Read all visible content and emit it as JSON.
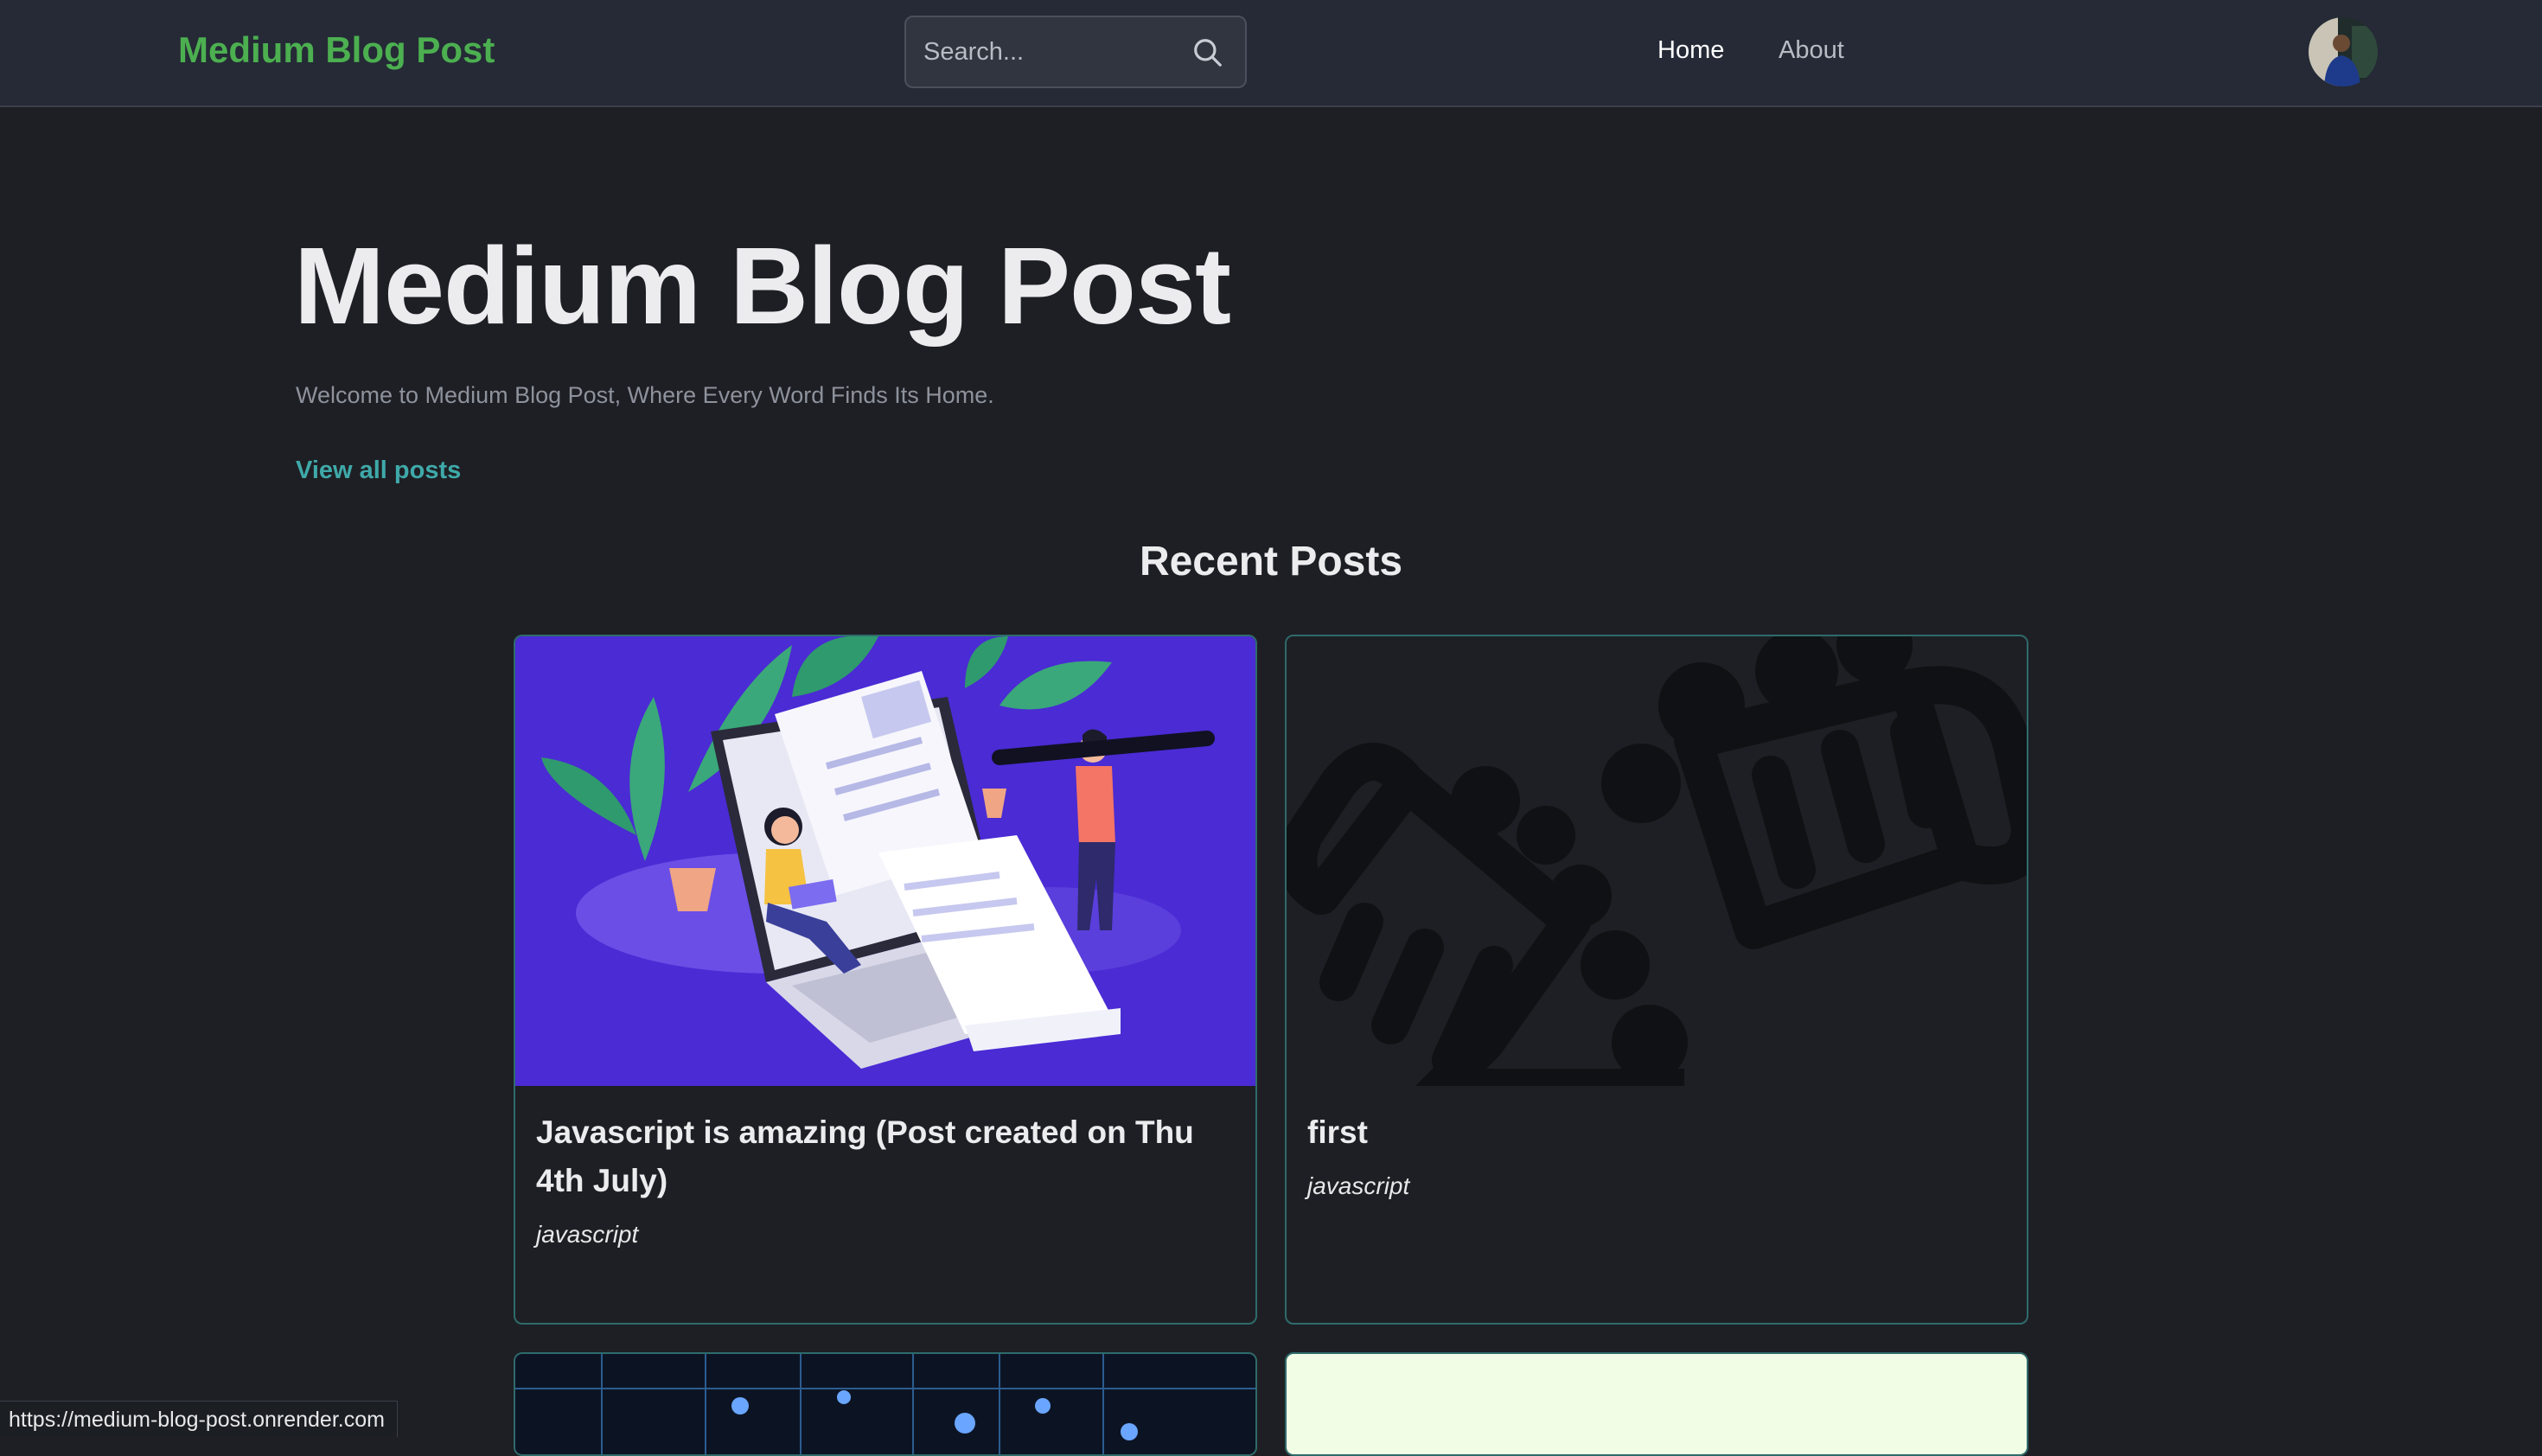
{
  "navbar": {
    "brand": "Medium Blog Post",
    "search_placeholder": "Search...",
    "links": [
      {
        "label": "Home",
        "active": true
      },
      {
        "label": "About",
        "active": false
      }
    ]
  },
  "hero": {
    "title": "Medium Blog Post",
    "subtitle": "Welcome to Medium Blog Post, Where Every Word Finds Its Home.",
    "cta": "View all posts"
  },
  "recent": {
    "heading": "Recent Posts",
    "posts": [
      {
        "title": "Javascript is amazing (Post created on Thu 4th July)",
        "tag": "javascript",
        "image": "blog-writing-illustration"
      },
      {
        "title": "first",
        "tag": "javascript",
        "image": "beer-mugs-icon"
      },
      {
        "title": "",
        "tag": "",
        "image": "tech-circuit-image"
      },
      {
        "title": "",
        "tag": "",
        "image": "light-green-image"
      }
    ]
  },
  "status_bar": {
    "url": "https://medium-blog-post.onrender.com"
  },
  "colors": {
    "background": "#1e1f24",
    "navbar": "#252a36",
    "brand": "#4caf50",
    "accent_link": "#3fa9a9",
    "card_border": "#2e6b6b",
    "card1_image_bg": "#4a2bd4"
  }
}
